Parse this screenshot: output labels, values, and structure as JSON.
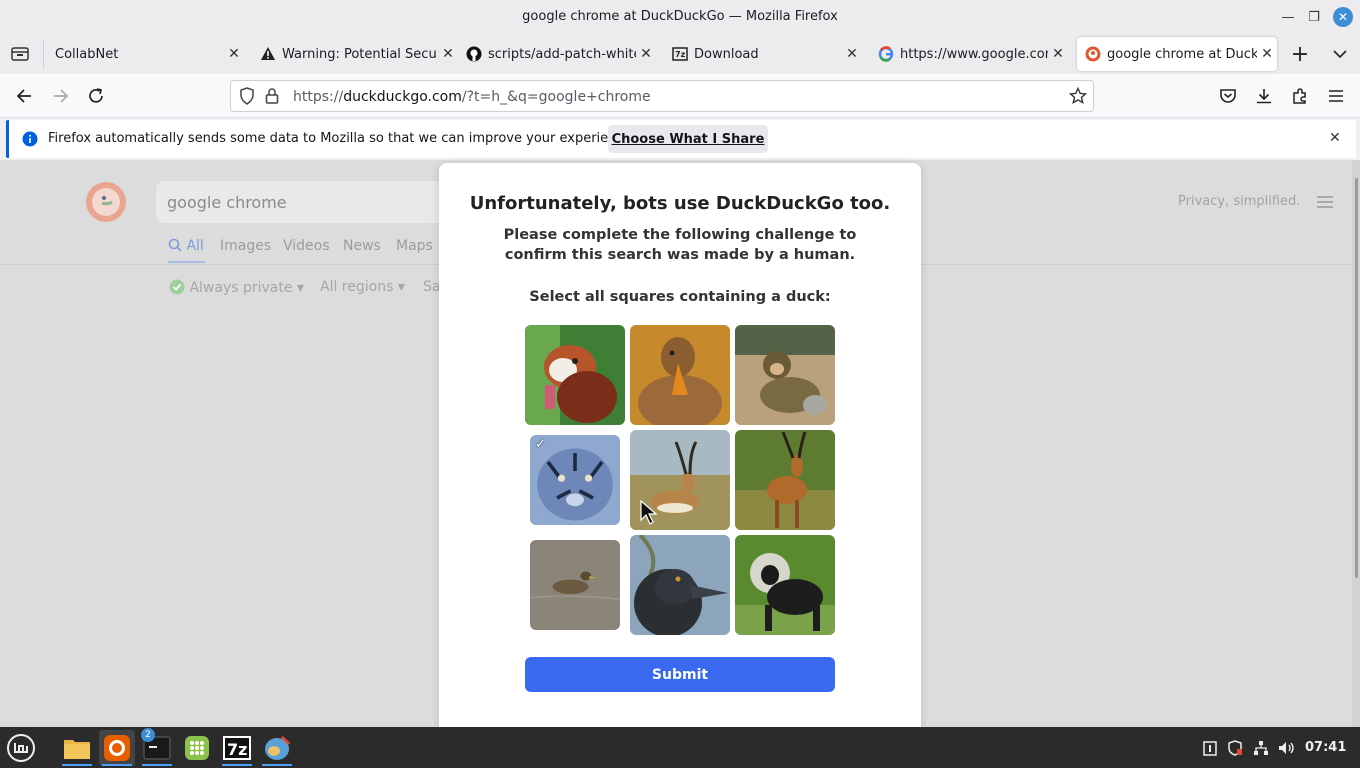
{
  "window": {
    "title": "google chrome at DuckDuckGo — Mozilla Firefox"
  },
  "tabs": [
    {
      "label": "CollabNet",
      "icon": "tab-list-icon"
    },
    {
      "label": "Warning: Potential Secu",
      "icon": "warning-icon"
    },
    {
      "label": "scripts/add-patch-whitel",
      "icon": "github-icon"
    },
    {
      "label": "Download",
      "icon": "download-page-icon"
    },
    {
      "label": "https://www.google.con",
      "icon": "google-icon"
    },
    {
      "label": "google chrome at DuckD",
      "icon": "duckduckgo-icon",
      "active": true
    }
  ],
  "urlbar": {
    "prefix": "https://",
    "domain": "duckduckgo.com",
    "path": "/?t=h_&q=google+chrome"
  },
  "notification": {
    "text": "Firefox automatically sends some data to Mozilla so that we can improve your experience.",
    "button": "Choose What I Share"
  },
  "ddg": {
    "search_value": "google chrome",
    "tabs": [
      "All",
      "Images",
      "Videos",
      "News",
      "Maps"
    ],
    "filters": [
      "Always private",
      "All regions",
      "Sa"
    ],
    "tagline": "Privacy, simplified."
  },
  "challenge": {
    "title": "Unfortunately, bots use DuckDuckGo too.",
    "subtitle": "Please complete the following challenge to confirm this search was made by a human.",
    "instruction": "Select all squares containing a duck:",
    "tiles": [
      {
        "subject": "red panda",
        "selected": false
      },
      {
        "subject": "duck",
        "selected": false
      },
      {
        "subject": "monkey",
        "selected": false
      },
      {
        "subject": "tiger",
        "selected": true
      },
      {
        "subject": "gazelle",
        "selected": false
      },
      {
        "subject": "gazelle",
        "selected": false
      },
      {
        "subject": "duck",
        "selected": true
      },
      {
        "subject": "duck",
        "selected": false
      },
      {
        "subject": "monkey",
        "selected": false
      }
    ],
    "submit": "Submit",
    "accent": "#3969ef"
  },
  "taskbar": {
    "terminal_badge": "2",
    "clock": "07:41"
  }
}
